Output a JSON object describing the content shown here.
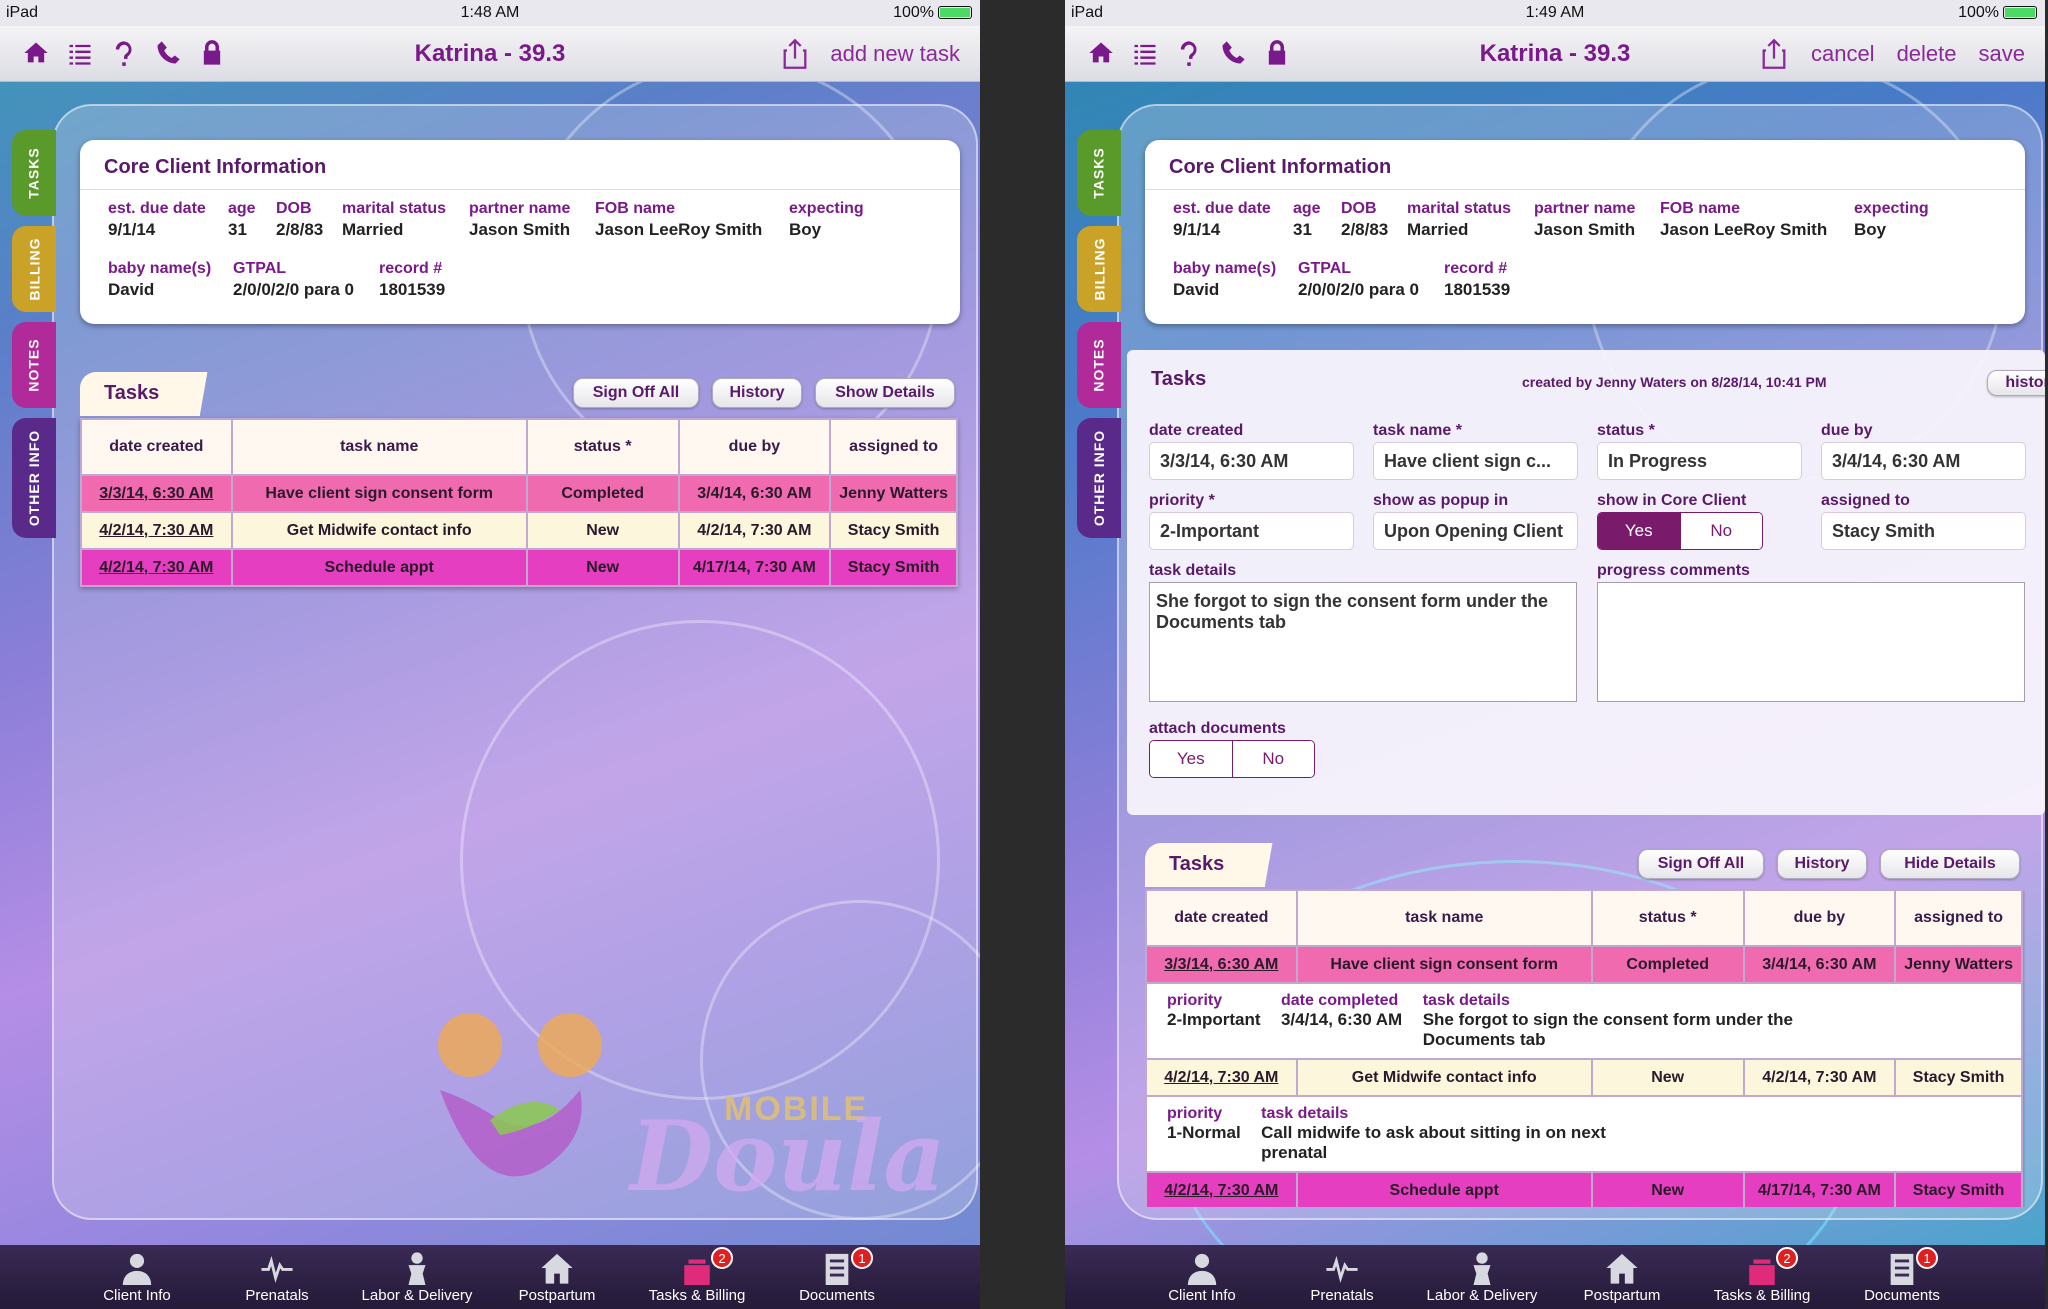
{
  "status_left": {
    "device": "iPad",
    "time": "1:48 AM",
    "battery": "100%"
  },
  "status_right": {
    "device": "iPad",
    "time": "1:49 AM",
    "battery": "100%"
  },
  "nav": {
    "title": "Katrina - 39.3",
    "icons": [
      "home-icon",
      "list-icon",
      "help-icon",
      "phone-icon",
      "lock-icon"
    ],
    "left_action": "add new task",
    "right_actions": [
      "cancel",
      "delete",
      "save"
    ]
  },
  "side_tabs": [
    "TASKS",
    "BILLING",
    "NOTES",
    "OTHER INFO"
  ],
  "core": {
    "title": "Core Client Information",
    "est_due_date": {
      "label": "est. due date",
      "value": "9/1/14"
    },
    "age": {
      "label": "age",
      "value": "31"
    },
    "dob": {
      "label": "DOB",
      "value": "2/8/83"
    },
    "marital": {
      "label": "marital status",
      "value": "Married"
    },
    "partner": {
      "label": "partner name",
      "value": "Jason Smith"
    },
    "fob": {
      "label": "FOB name",
      "value": "Jason LeeRoy Smith"
    },
    "expecting": {
      "label": "expecting",
      "value": "Boy"
    },
    "baby": {
      "label": "baby name(s)",
      "value": "David"
    },
    "gtpal": {
      "label": "GTPAL",
      "value": "2/0/0/2/0 para 0"
    },
    "record": {
      "label": "record #",
      "value": "1801539"
    }
  },
  "tasks": {
    "title": "Tasks",
    "buttons": {
      "sign_off": "Sign Off All",
      "history": "History",
      "show_details": "Show Details",
      "hide_details": "Hide Details"
    },
    "columns": [
      "date created",
      "task name",
      "status *",
      "due by",
      "assigned to"
    ],
    "rows": [
      {
        "date": "3/3/14, 6:30 AM",
        "name": "Have client sign consent form",
        "status": "Completed",
        "due": "3/4/14, 6:30 AM",
        "assigned": "Jenny Watters"
      },
      {
        "date": "4/2/14, 7:30 AM",
        "name": "Get Midwife contact info",
        "status": "New",
        "due": "4/2/14, 7:30 AM",
        "assigned": "Stacy Smith"
      },
      {
        "date": "4/2/14, 7:30 AM",
        "name": "Schedule appt",
        "status": "New",
        "due": "4/17/14, 7:30 AM",
        "assigned": "Stacy Smith"
      }
    ],
    "details": [
      {
        "priority_label": "priority",
        "priority": "2-Important",
        "completed_label": "date completed",
        "completed": "3/4/14, 6:30 AM",
        "details_label": "task details",
        "details": "She forgot to sign the consent form under the Documents tab"
      },
      {
        "priority_label": "priority",
        "priority": "1-Normal",
        "details_label": "task details",
        "details": "Call midwife to ask about sitting in on next prenatal"
      }
    ]
  },
  "edit": {
    "title": "Tasks",
    "created": "created by Jenny Waters on 8/28/14, 10:41 PM",
    "history_btn": "history",
    "date_created": {
      "label": "date created",
      "value": "3/3/14, 6:30 AM"
    },
    "task_name": {
      "label": "task name *",
      "value": "Have client sign c..."
    },
    "status": {
      "label": "status *",
      "value": "In Progress"
    },
    "due_by": {
      "label": "due by",
      "value": "3/4/14, 6:30 AM"
    },
    "priority": {
      "label": "priority *",
      "value": "2-Important"
    },
    "popup": {
      "label": "show as popup in",
      "value": "Upon Opening Client"
    },
    "show_core": {
      "label": "show in Core Client",
      "yes": "Yes",
      "no": "No"
    },
    "assigned": {
      "label": "assigned to",
      "value": "Stacy Smith"
    },
    "task_details": {
      "label": "task details",
      "value": "She forgot to sign the consent form under the Documents tab"
    },
    "progress": {
      "label": "progress comments",
      "value": ""
    },
    "attach": {
      "label": "attach documents",
      "yes": "Yes",
      "no": "No"
    }
  },
  "tabbar": [
    {
      "label": "Client Info",
      "icon": "person-icon"
    },
    {
      "label": "Prenatals",
      "icon": "heartbeat-icon"
    },
    {
      "label": "Labor & Delivery",
      "icon": "baby-icon"
    },
    {
      "label": "Postpartum",
      "icon": "house-icon"
    },
    {
      "label": "Tasks & Billing",
      "icon": "tasks-icon",
      "badge": "2"
    },
    {
      "label": "Documents",
      "icon": "documents-icon",
      "badge": "1"
    }
  ],
  "logo": {
    "mobile": "MOBILE",
    "doula": "Doula"
  },
  "colors": {
    "brand": "#7a1a8a",
    "completed_row": "#f06ab0",
    "new_row": "#fcf6dc",
    "magenta_row": "#e63ec0",
    "tabbar": "#2e2244"
  }
}
